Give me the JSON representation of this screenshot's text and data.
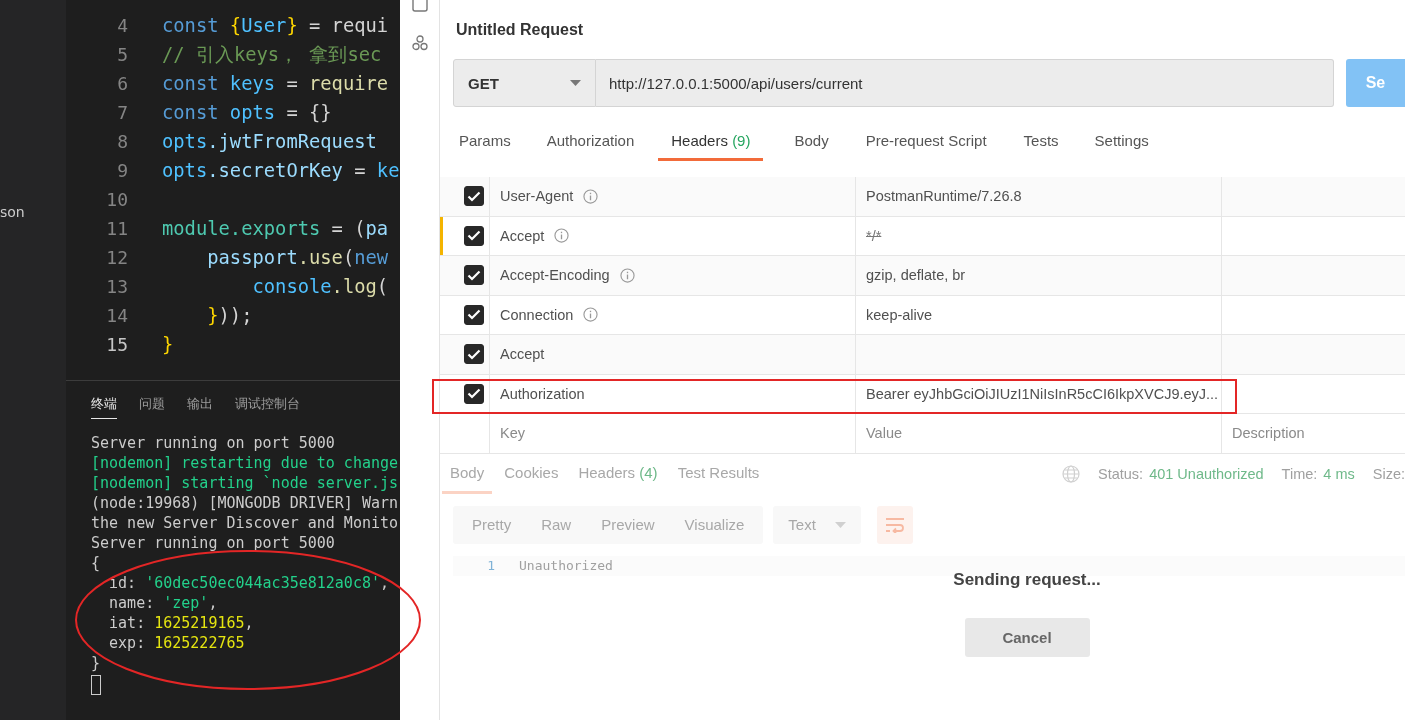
{
  "explorer": {
    "item": "son"
  },
  "editor": {
    "lines": [
      {
        "number": "4",
        "current": false,
        "tokens": [
          {
            "text": "const ",
            "kind": "keyword"
          },
          {
            "text": "{",
            "kind": "bracket"
          },
          {
            "text": "User",
            "kind": "variable"
          },
          {
            "text": "}",
            "kind": "bracket"
          },
          {
            "text": " = requi",
            "kind": "plain"
          }
        ]
      },
      {
        "number": "5",
        "current": false,
        "tokens": [
          {
            "text": "// 引入keys， 拿到sec",
            "kind": "comment"
          }
        ]
      },
      {
        "number": "6",
        "current": false,
        "tokens": [
          {
            "text": "const ",
            "kind": "keyword"
          },
          {
            "text": "keys",
            "kind": "variable"
          },
          {
            "text": " = ",
            "kind": "plain"
          },
          {
            "text": "require",
            "kind": "function"
          }
        ]
      },
      {
        "number": "7",
        "current": false,
        "tokens": [
          {
            "text": "const ",
            "kind": "keyword"
          },
          {
            "text": "opts",
            "kind": "variable"
          },
          {
            "text": " = ",
            "kind": "plain"
          },
          {
            "text": "{}",
            "kind": "plain"
          }
        ]
      },
      {
        "number": "8",
        "current": false,
        "tokens": [
          {
            "text": "opts",
            "kind": "variable"
          },
          {
            "text": ".jwtFromRequest",
            "kind": "param"
          }
        ]
      },
      {
        "number": "9",
        "current": false,
        "tokens": [
          {
            "text": "opts",
            "kind": "variable"
          },
          {
            "text": ".secretOrKey",
            "kind": "param"
          },
          {
            "text": " = ",
            "kind": "plain"
          },
          {
            "text": "ke",
            "kind": "variable"
          }
        ]
      },
      {
        "number": "10",
        "current": false
      },
      {
        "number": "11",
        "current": false,
        "tokens": [
          {
            "text": "module",
            "kind": "module"
          },
          {
            "text": ".exports",
            "kind": "module"
          },
          {
            "text": " = (",
            "kind": "plain"
          },
          {
            "text": "pa",
            "kind": "param"
          }
        ]
      },
      {
        "number": "12",
        "current": false,
        "tokens": [
          {
            "text": "    passport",
            "kind": "param"
          },
          {
            "text": ".use",
            "kind": "function"
          },
          {
            "text": "(",
            "kind": "plain"
          },
          {
            "text": "new",
            "kind": "keyword"
          }
        ]
      },
      {
        "number": "13",
        "current": false,
        "tokens": [
          {
            "text": "        console",
            "kind": "variable"
          },
          {
            "text": ".log",
            "kind": "function"
          },
          {
            "text": "(",
            "kind": "plain"
          }
        ]
      },
      {
        "number": "14",
        "current": false,
        "tokens": [
          {
            "text": "    }",
            "kind": "bracket"
          },
          {
            "text": "));",
            "kind": "plain"
          }
        ]
      },
      {
        "number": "15",
        "current": true,
        "tokens": [
          {
            "text": "}",
            "kind": "bracket"
          }
        ]
      }
    ]
  },
  "terminal": {
    "tabs": [
      {
        "label": "终端",
        "selected": true
      },
      {
        "label": "问题",
        "selected": false
      },
      {
        "label": "输出",
        "selected": false
      },
      {
        "label": "调试控制台",
        "selected": false
      }
    ],
    "lines": [
      [
        {
          "text": "Server running on port 5000",
          "kind": "plain"
        }
      ],
      [
        {
          "text": "[nodemon] restarting due to change",
          "kind": "green"
        }
      ],
      [
        {
          "text": "[nodemon] starting `node server.js",
          "kind": "green"
        }
      ],
      [
        {
          "text": "(node:19968) [MONGODB DRIVER] Warn",
          "kind": "plain"
        }
      ],
      [
        {
          "text": "the new Server Discover and Monito",
          "kind": "plain"
        }
      ],
      [
        {
          "text": "Server running on port 5000",
          "kind": "plain"
        }
      ],
      [
        {
          "text": "{",
          "kind": "plain"
        }
      ],
      [
        {
          "text": "  id: ",
          "kind": "plain"
        },
        {
          "text": "'60dec50ec044ac35e812a0c8'",
          "kind": "string"
        },
        {
          "text": ",",
          "kind": "plain"
        }
      ],
      [
        {
          "text": "  name: ",
          "kind": "plain"
        },
        {
          "text": "'zep'",
          "kind": "string"
        },
        {
          "text": ",",
          "kind": "plain"
        }
      ],
      [
        {
          "text": "  iat: ",
          "kind": "plain"
        },
        {
          "text": "1625219165",
          "kind": "number"
        },
        {
          "text": ",",
          "kind": "plain"
        }
      ],
      [
        {
          "text": "  exp: ",
          "kind": "plain"
        },
        {
          "text": "1625222765",
          "kind": "number"
        }
      ],
      [
        {
          "text": "}",
          "kind": "plain"
        }
      ]
    ]
  },
  "postman": {
    "title": "Untitled Request",
    "method": "GET",
    "url": "http://127.0.0.1:5000/api/users/current",
    "send": "Se",
    "tabs": [
      {
        "label": "Params",
        "selected": false
      },
      {
        "label": "Authorization",
        "selected": false
      },
      {
        "label": "Headers",
        "count": "(9)",
        "selected": true
      },
      {
        "label": "Body",
        "selected": false
      },
      {
        "label": "Pre-request Script",
        "selected": false
      },
      {
        "label": "Tests",
        "selected": false
      },
      {
        "label": "Settings",
        "selected": false
      }
    ],
    "headers": [
      {
        "checked": true,
        "key": "User-Agent",
        "info": true,
        "value": "PostmanRuntime/7.26.8",
        "overridden": false,
        "struck": false,
        "highlighted": false
      },
      {
        "checked": true,
        "key": "Accept",
        "info": true,
        "value": "*/*",
        "overridden": true,
        "struck": true,
        "highlighted": false
      },
      {
        "checked": true,
        "key": "Accept-Encoding",
        "info": true,
        "value": "gzip, deflate, br",
        "overridden": false,
        "struck": false,
        "highlighted": false
      },
      {
        "checked": true,
        "key": "Connection",
        "info": true,
        "value": "keep-alive",
        "overridden": false,
        "struck": false,
        "highlighted": false
      },
      {
        "checked": true,
        "key": "Accept",
        "info": false,
        "overridden": false,
        "highlighted": false
      },
      {
        "checked": true,
        "key": "Authorization",
        "info": false,
        "value": "Bearer eyJhbGciOiJIUzI1NiIsInR5cCI6IkpXVCJ9.eyJ...",
        "overridden": false,
        "struck": false,
        "highlighted": true
      }
    ],
    "new_row": {
      "key": "Key",
      "value": "Value",
      "description": "Description"
    },
    "response": {
      "tabs": [
        {
          "label": "Body",
          "selected": true
        },
        {
          "label": "Cookies",
          "selected": false
        },
        {
          "label": "Headers",
          "count": "(4)",
          "selected": false
        },
        {
          "label": "Test Results",
          "selected": false
        }
      ],
      "status_label": "Status:",
      "status": "401 Unauthorized",
      "time_label": "Time:",
      "time": "4 ms",
      "size_label": "Size:",
      "views": [
        "Pretty",
        "Raw",
        "Preview",
        "Visualize"
      ],
      "format": "Text",
      "lines": [
        {
          "number": "1",
          "text": "Unauthorized"
        }
      ]
    },
    "overlay": {
      "message": "Sending request...",
      "cancel": "Cancel"
    }
  },
  "annotations": [
    {
      "kind": "ellipse"
    }
  ]
}
